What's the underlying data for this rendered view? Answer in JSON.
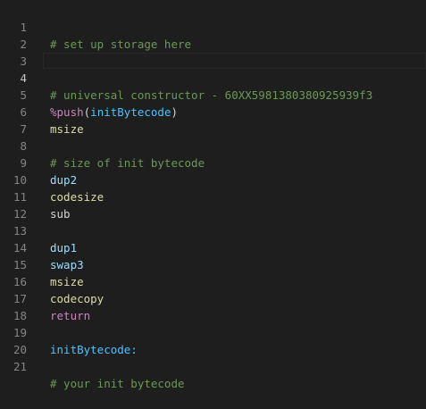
{
  "editor": {
    "lines": [
      {
        "number": "1",
        "text": "# set up storage here"
      },
      {
        "number": "2",
        "text": ""
      },
      {
        "number": "3",
        "text": ""
      },
      {
        "number": "4",
        "text": "# universal constructor - 60XX5981380380925939f3"
      },
      {
        "number": "5",
        "macro": "%push",
        "open": "(",
        "arg": "initBytecode",
        "close": ")"
      },
      {
        "number": "6",
        "text": "msize"
      },
      {
        "number": "7",
        "text": ""
      },
      {
        "number": "8",
        "text": "# size of init bytecode"
      },
      {
        "number": "9",
        "text": "dup2"
      },
      {
        "number": "10",
        "text": "codesize"
      },
      {
        "number": "11",
        "text": "sub"
      },
      {
        "number": "12",
        "text": ""
      },
      {
        "number": "13",
        "text": "dup1"
      },
      {
        "number": "14",
        "text": "swap3"
      },
      {
        "number": "15",
        "text": "msize"
      },
      {
        "number": "16",
        "text": "codecopy"
      },
      {
        "number": "17",
        "text": "return"
      },
      {
        "number": "18",
        "text": ""
      },
      {
        "number": "19",
        "text": "initBytecode:"
      },
      {
        "number": "20",
        "text": ""
      },
      {
        "number": "21",
        "text": "# your init bytecode"
      }
    ]
  }
}
